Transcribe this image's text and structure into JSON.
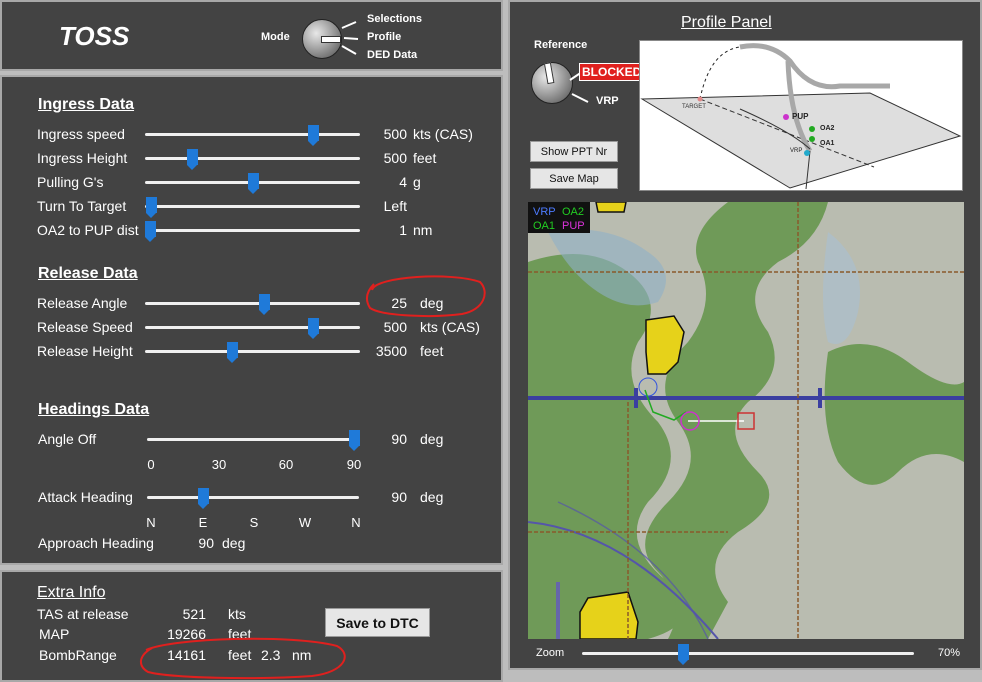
{
  "app": {
    "title": "TOSS"
  },
  "mode": {
    "label": "Mode",
    "options": [
      "Selections",
      "Profile",
      "DED Data"
    ]
  },
  "ingress": {
    "title": "Ingress Data",
    "rows": [
      {
        "label": "Ingress speed",
        "value": "500",
        "unit": "kts (CAS)",
        "level": 0.78
      },
      {
        "label": "Ingress Height",
        "value": "500",
        "unit": "feet",
        "level": 0.22
      },
      {
        "label": "Pulling G's",
        "value": "4",
        "unit": "g",
        "level": 0.5
      },
      {
        "label": "Turn To Target",
        "value": "Left",
        "unit": "",
        "level": 0.0
      },
      {
        "label": "OA2 to PUP dist",
        "value": "1",
        "unit": "nm",
        "level": 0.0
      }
    ]
  },
  "release": {
    "title": "Release Data",
    "rows": [
      {
        "label": "Release Angle",
        "value": "25",
        "unit": "deg",
        "level": 0.55
      },
      {
        "label": "Release Speed",
        "value": "500",
        "unit": "kts (CAS)",
        "level": 0.78
      },
      {
        "label": "Release Height",
        "value": "3500",
        "unit": "feet",
        "level": 0.41
      }
    ]
  },
  "headings": {
    "title": "Headings Data",
    "angle_off": {
      "label": "Angle Off",
      "value": "90",
      "unit": "deg",
      "level": 1.0,
      "ticks": [
        "0",
        "30",
        "60",
        "90"
      ]
    },
    "attack": {
      "label": "Attack Heading",
      "value": "90",
      "unit": "deg",
      "level": 0.25,
      "ticks": [
        "N",
        "E",
        "S",
        "W",
        "N"
      ]
    },
    "approach": {
      "label": "Approach Heading",
      "value": "90",
      "unit": "deg"
    }
  },
  "extra": {
    "title": "Extra Info",
    "tas": {
      "label": "TAS at release",
      "value": "521",
      "unit": "kts"
    },
    "map": {
      "label": "MAP",
      "value": "19266",
      "unit": "feet"
    },
    "bomb": {
      "label": "BombRange",
      "value": "14161",
      "unit": "feet",
      "value2": "2.3",
      "unit2": "nm"
    },
    "save_btn": "Save to DTC"
  },
  "profile": {
    "title": "Profile Panel",
    "reference_label": "Reference",
    "blocked": "BLOCKED",
    "vrp": "VRP",
    "show_ppt": "Show PPT Nr",
    "save_map": "Save Map",
    "diagram": {
      "target": "TARGET",
      "pup": "PUP",
      "oa2": "OA2",
      "oa1": "OA1",
      "vrp": "VRP"
    }
  },
  "legend": {
    "vrp": "VRP",
    "oa2": "OA2",
    "oa1": "OA1",
    "pup": "PUP"
  },
  "zoom": {
    "label": "Zoom",
    "value": "70%",
    "level": 0.3
  },
  "colors": {
    "panel": "#434343",
    "accent": "#1f7ad9",
    "blocked": "#e0201e",
    "annotation": "#e0201e"
  }
}
